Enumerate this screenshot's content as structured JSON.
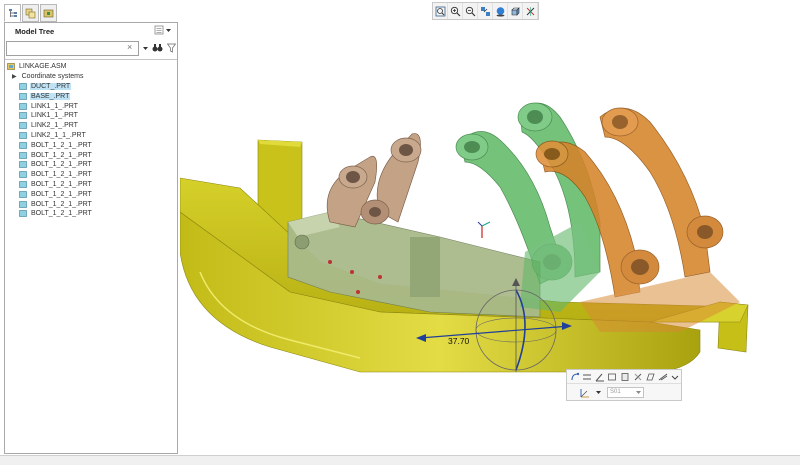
{
  "model_tree": {
    "title": "Model Tree",
    "search_value": "",
    "search_clear": "×",
    "root": "LINKAGE.ASM",
    "items": [
      {
        "label": "Coordinate systems",
        "kind": "folder"
      },
      {
        "label": "DUCT_.PRT",
        "kind": "part",
        "highlighted": true
      },
      {
        "label": "BASE_.PRT",
        "kind": "part",
        "highlighted": true
      },
      {
        "label": "LINK1_1_.PRT",
        "kind": "part"
      },
      {
        "label": "LINK1_1_.PRT",
        "kind": "part"
      },
      {
        "label": "LINK2_1_.PRT",
        "kind": "part"
      },
      {
        "label": "LINK2_1_1_.PRT",
        "kind": "part"
      },
      {
        "label": "BOLT_1_2_1_.PRT",
        "kind": "part"
      },
      {
        "label": "BOLT_1_2_1_.PRT",
        "kind": "part"
      },
      {
        "label": "BOLT_1_2_1_.PRT",
        "kind": "part"
      },
      {
        "label": "BOLT_1_2_1_.PRT",
        "kind": "part"
      },
      {
        "label": "BOLT_1_2_1_.PRT",
        "kind": "part"
      },
      {
        "label": "BOLT_1_2_1_.PRT",
        "kind": "part"
      },
      {
        "label": "BOLT_1_2_1_.PRT",
        "kind": "part"
      },
      {
        "label": "BOLT_1_2_1_.PRT",
        "kind": "part"
      }
    ]
  },
  "dragger": {
    "dimension": "37.70"
  },
  "mini_toolbar": {
    "reference_select": "S01"
  },
  "colors": {
    "duct": "#c8c21a",
    "base": "#a7b786",
    "link1": "#bf9f84",
    "link2": "#5fb566",
    "link3": "#d2801f",
    "highlight": "#bfe3f5"
  },
  "icons": {
    "panel_tabs": [
      "model-tree-tab-icon",
      "layers-tab-icon",
      "folder-tab-icon"
    ],
    "graphics_toolbar": [
      "refit-icon",
      "zoom-in-icon",
      "zoom-out-icon",
      "repaint-icon",
      "saved-views-icon",
      "display-style-icon",
      "datum-display-icon"
    ]
  }
}
